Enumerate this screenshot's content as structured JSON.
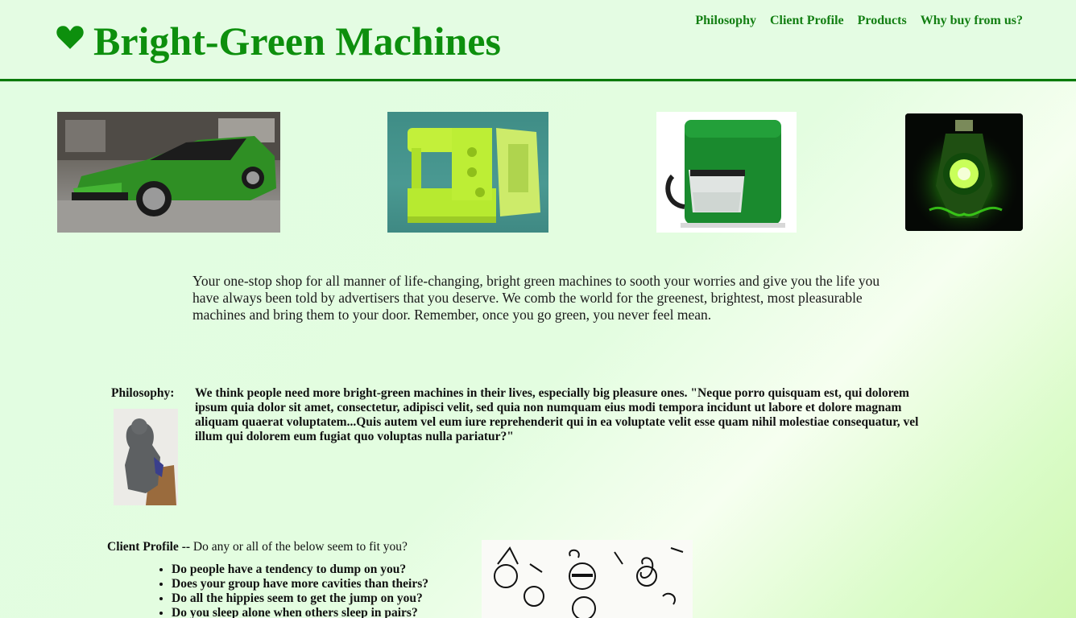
{
  "brand": {
    "title": "Bright-Green Machines",
    "icon": "heart-icon",
    "color": "#0d8f0d"
  },
  "nav": {
    "items": [
      "Philosophy",
      "Client Profile",
      "Products",
      "Why buy from us?"
    ]
  },
  "gallery": {
    "images": [
      "green-car-image",
      "green-sewing-machine-image",
      "green-coffee-maker-image",
      "green-lantern-image"
    ]
  },
  "intro": {
    "text": "Your one-stop shop for all manner of life-changing, bright green machines to sooth your worries and give you the life you have always been told by advertisers that you deserve. We comb the world for the greenest, brightest, most pleasurable machines and bring them to your door. Remember, once you go green, you never feel mean."
  },
  "philosophy": {
    "label": "Philosophy:",
    "text": "We think people need more bright-green machines in their lives, especially big pleasure ones. \"Neque porro quisquam est, qui dolorem ipsum quia dolor sit amet, consectetur, adipisci velit, sed quia non numquam eius modi tempora incidunt ut labore et dolore magnam aliquam quaerat voluptatem...Quis autem vel eum iure reprehenderit qui in ea voluptate velit esse quam nihil molestiae consequatur, vel illum qui dolorem eum fugiat quo voluptas nulla pariatur?\""
  },
  "client_profile": {
    "label": "Client Profile --",
    "question": "Do any or all of the below seem to fit you?",
    "items": [
      "Do people have a tendency to dump on you?",
      "Does your group have more cavities than theirs?",
      "Do all the hippies seem to get the jump on you?",
      "Do you sleep alone when others sleep in pairs?"
    ]
  }
}
